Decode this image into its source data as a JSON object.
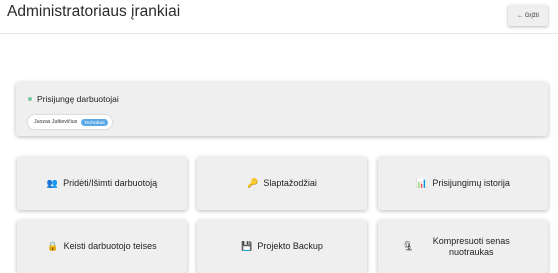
{
  "header": {
    "title": "Administratoriaus įrankiai",
    "back_label": "← Grįžti"
  },
  "online": {
    "heading": "Prisijungę darbuotojai",
    "status_color": "#79c79d",
    "users": [
      {
        "name": "Juozas Jutkevičius",
        "role": "Technikas",
        "role_color": "#5aa9e6"
      }
    ]
  },
  "tools": [
    {
      "label": "Pridėti/Išimti darbuotoją",
      "icon": "people-icon",
      "glyph": "👥"
    },
    {
      "label": "Slaptažodžiai",
      "icon": "key-icon",
      "glyph": "🔑"
    },
    {
      "label": "Prisijungimų istorija",
      "icon": "bar-chart-icon",
      "glyph": "📊"
    },
    {
      "label": "Keisti darbuotojo teises",
      "icon": "lock-icon",
      "glyph": "🔒"
    },
    {
      "label": "Projekto Backup",
      "icon": "floppy-disk-icon",
      "glyph": "💾"
    },
    {
      "label": "Kompresuoti senas nuotraukas",
      "icon": "clamp-icon",
      "glyph": "🗜"
    }
  ]
}
